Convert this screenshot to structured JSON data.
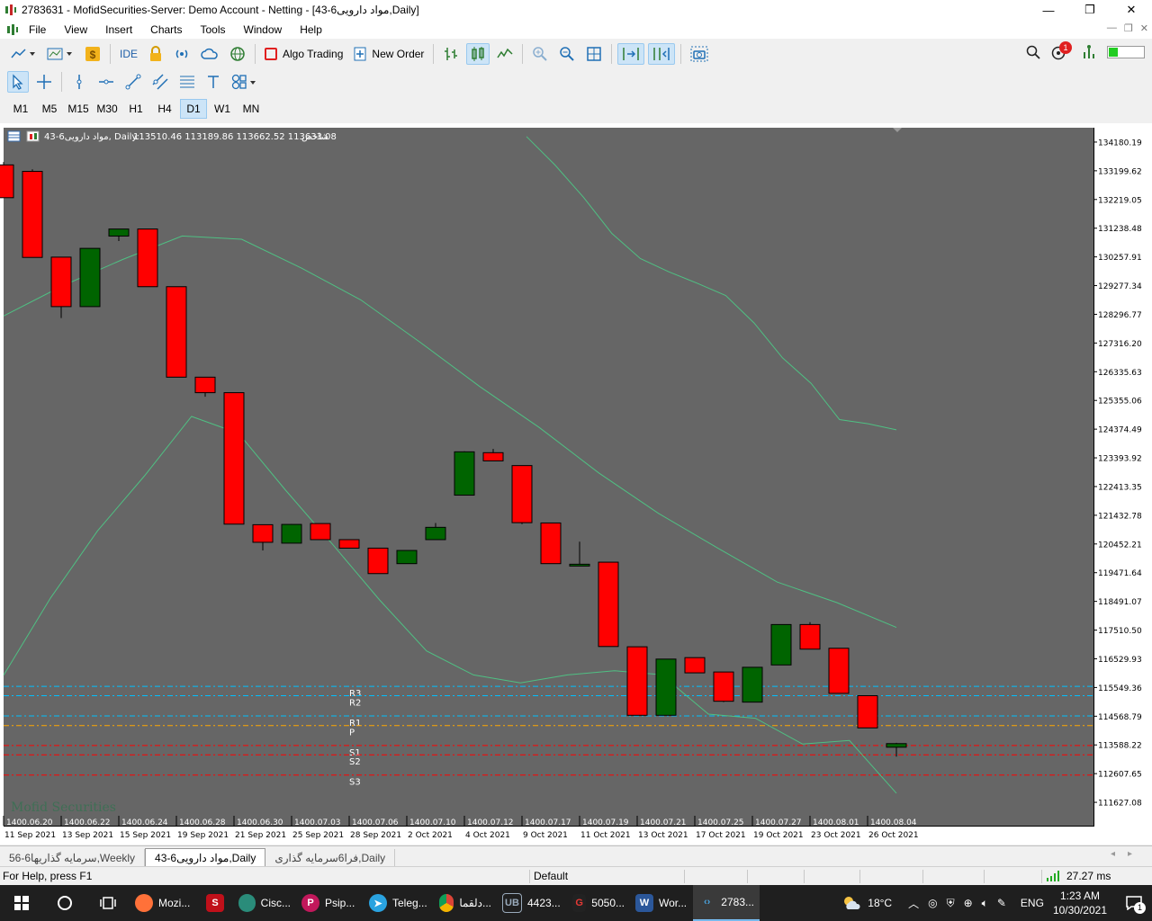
{
  "window": {
    "title": "2783631 - MofidSecurities-Server: Demo Account - Netting - [43-6مواد دارویی,Daily]",
    "controls": [
      "—",
      "❐",
      "✕"
    ]
  },
  "menu": {
    "items": [
      "File",
      "View",
      "Insert",
      "Charts",
      "Tools",
      "Window",
      "Help"
    ]
  },
  "toolbar": {
    "ide_label": "IDE",
    "algo_label": "Algo Trading",
    "new_order_label": "New Order",
    "alert_count": "1"
  },
  "timeframes": {
    "items": [
      "M1",
      "M5",
      "M15",
      "M30",
      "H1",
      "H4",
      "D1",
      "W1",
      "MN"
    ],
    "active": "D1"
  },
  "chart_header": {
    "symbol": "43-6مواد دارویی, Daily:",
    "ohlc": "113510.46 113189.86 113662.52 113633.08",
    "index_label": "شاخص"
  },
  "watermark": "Mofid Securities",
  "tabs": {
    "items": [
      "56-6سرمایه گذاریها,Weekly",
      "43-6مواد دارویی,Daily",
      "فرا6سرمایه گذاری,Daily"
    ],
    "active_index": 1
  },
  "status": {
    "help": "For Help, press F1",
    "profile": "Default",
    "ping": "27.27 ms"
  },
  "taskbar": {
    "items": [
      {
        "label": "Mozi...",
        "icon": "firefox-icon"
      },
      {
        "label": "",
        "icon": "app-red-icon"
      },
      {
        "label": "Cisc...",
        "icon": "cisco-icon"
      },
      {
        "label": "Psip...",
        "icon": "psiphon-icon"
      },
      {
        "label": "Teleg...",
        "icon": "telegram-icon"
      },
      {
        "label": "دلقما...",
        "icon": "chrome-icon"
      },
      {
        "label": "4423...",
        "icon": "ub-icon"
      },
      {
        "label": "5050...",
        "icon": "g-icon"
      },
      {
        "label": "Wor...",
        "icon": "word-icon"
      },
      {
        "label": "2783...",
        "icon": "metatrader-icon"
      }
    ],
    "weather": "18°C",
    "lang": "ENG",
    "time": "1:23 AM",
    "date": "10/30/2021",
    "notif_count": "1"
  },
  "colors": {
    "bull": "#006400",
    "bear": "#ff0000",
    "background": "#666666",
    "band": "#4fc083",
    "pivot_r": "#00c0ff",
    "pivot_p": "#ffa500",
    "pivot_s": "#ff0000"
  },
  "chart_data": {
    "type": "candlestick",
    "ylim": [
      111137.5,
      134670.4
    ],
    "y_ticks": [
      "134180.19",
      "133199.62",
      "132219.05",
      "131238.48",
      "130257.91",
      "129277.34",
      "128296.77",
      "127316.20",
      "126335.63",
      "125355.06",
      "124374.49",
      "123393.92",
      "122413.35",
      "121432.78",
      "120452.21",
      "119471.64",
      "118491.07",
      "117510.50",
      "116529.93",
      "115549.36",
      "114568.79",
      "113588.22",
      "112607.65",
      "111627.08"
    ],
    "date_labels_top": [
      "1400.06.20",
      "1400.06.22",
      "1400.06.24",
      "1400.06.28",
      "1400.06.30",
      "1400.07.03",
      "1400.07.06",
      "1400.07.10",
      "1400.07.12",
      "1400.07.17",
      "1400.07.19",
      "1400.07.21",
      "1400.07.25",
      "1400.07.27",
      "1400.08.01",
      "1400.08.04"
    ],
    "date_labels_bottom": [
      "11 Sep 2021",
      "13 Sep 2021",
      "15 Sep 2021",
      "19 Sep 2021",
      "21 Sep 2021",
      "25 Sep 2021",
      "28 Sep 2021",
      "2 Oct 2021",
      "4 Oct 2021",
      "9 Oct 2021",
      "11 Oct 2021",
      "13 Oct 2021",
      "17 Oct 2021",
      "19 Oct 2021",
      "23 Oct 2021",
      "26 Oct 2021"
    ],
    "candles": [
      {
        "o": 133400,
        "h": 133500,
        "l": 132280,
        "c": 132280
      },
      {
        "o": 133180,
        "h": 133250,
        "l": 130240,
        "c": 130240
      },
      {
        "o": 130250,
        "h": 130250,
        "l": 128170,
        "c": 128560
      },
      {
        "o": 128560,
        "h": 130550,
        "l": 128560,
        "c": 130550
      },
      {
        "o": 130970,
        "h": 131060,
        "l": 130800,
        "c": 131210
      },
      {
        "o": 131210,
        "h": 131210,
        "l": 129240,
        "c": 129240
      },
      {
        "o": 129240,
        "h": 129240,
        "l": 126150,
        "c": 126150
      },
      {
        "o": 126150,
        "h": 126150,
        "l": 125480,
        "c": 125620
      },
      {
        "o": 125620,
        "h": 125620,
        "l": 121130,
        "c": 121130
      },
      {
        "o": 121110,
        "h": 121110,
        "l": 120230,
        "c": 120510
      },
      {
        "o": 120480,
        "h": 121130,
        "l": 120480,
        "c": 121120
      },
      {
        "o": 121150,
        "h": 121150,
        "l": 120600,
        "c": 120600
      },
      {
        "o": 120600,
        "h": 120600,
        "l": 120310,
        "c": 120310
      },
      {
        "o": 120310,
        "h": 120310,
        "l": 119490,
        "c": 119440
      },
      {
        "o": 119780,
        "h": 120230,
        "l": 119780,
        "c": 120230
      },
      {
        "o": 120600,
        "h": 121170,
        "l": 120600,
        "c": 121020
      },
      {
        "o": 122120,
        "h": 123620,
        "l": 122120,
        "c": 123600
      },
      {
        "o": 123570,
        "h": 123700,
        "l": 123290,
        "c": 123290
      },
      {
        "o": 123130,
        "h": 123130,
        "l": 121130,
        "c": 121180
      },
      {
        "o": 121170,
        "h": 121170,
        "l": 119780,
        "c": 119780
      },
      {
        "o": 119760,
        "h": 120530,
        "l": 119760,
        "c": 119760
      },
      {
        "o": 119830,
        "h": 119830,
        "l": 116950,
        "c": 116950
      },
      {
        "o": 116940,
        "h": 116940,
        "l": 114690,
        "c": 114600
      },
      {
        "o": 114600,
        "h": 116520,
        "l": 114600,
        "c": 116520
      },
      {
        "o": 116570,
        "h": 116570,
        "l": 116050,
        "c": 116050
      },
      {
        "o": 116080,
        "h": 116080,
        "l": 115050,
        "c": 115080
      },
      {
        "o": 115050,
        "h": 116240,
        "l": 115050,
        "c": 116240
      },
      {
        "o": 116320,
        "h": 117700,
        "l": 116320,
        "c": 117700
      },
      {
        "o": 117700,
        "h": 117780,
        "l": 116860,
        "c": 116860
      },
      {
        "o": 116890,
        "h": 116890,
        "l": 115350,
        "c": 115350
      },
      {
        "o": 115270,
        "h": 115270,
        "l": 114170,
        "c": 114170
      },
      {
        "o": 113510,
        "h": 113662,
        "l": 113190,
        "c": 113633
      }
    ],
    "bands": {
      "upper": [
        134370,
        133400,
        132300,
        131060,
        130200,
        129750,
        129360,
        128940,
        128000,
        126810,
        125940,
        124700,
        124560,
        124350
      ],
      "middle": [
        128240,
        129280,
        130170,
        130970,
        130860,
        129880,
        128790,
        127340,
        125830,
        124430,
        122880,
        121500,
        120310,
        119150,
        118450,
        117600
      ],
      "lower": [
        115970,
        118610,
        120900,
        122780,
        124810,
        124230,
        122290,
        120440,
        118540,
        116800,
        115980,
        115710,
        115980,
        116120,
        115990,
        114640,
        114500,
        113620,
        113740,
        111940
      ]
    },
    "pivots": [
      {
        "label": "R3",
        "value": 115590
      },
      {
        "label": "R2",
        "value": 115270
      },
      {
        "label": "R1",
        "value": 114580
      },
      {
        "label": "P",
        "value": 114250
      },
      {
        "label": "S1",
        "value": 113570
      },
      {
        "label": "S2",
        "value": 113250
      },
      {
        "label": "S3",
        "value": 112560
      }
    ]
  }
}
